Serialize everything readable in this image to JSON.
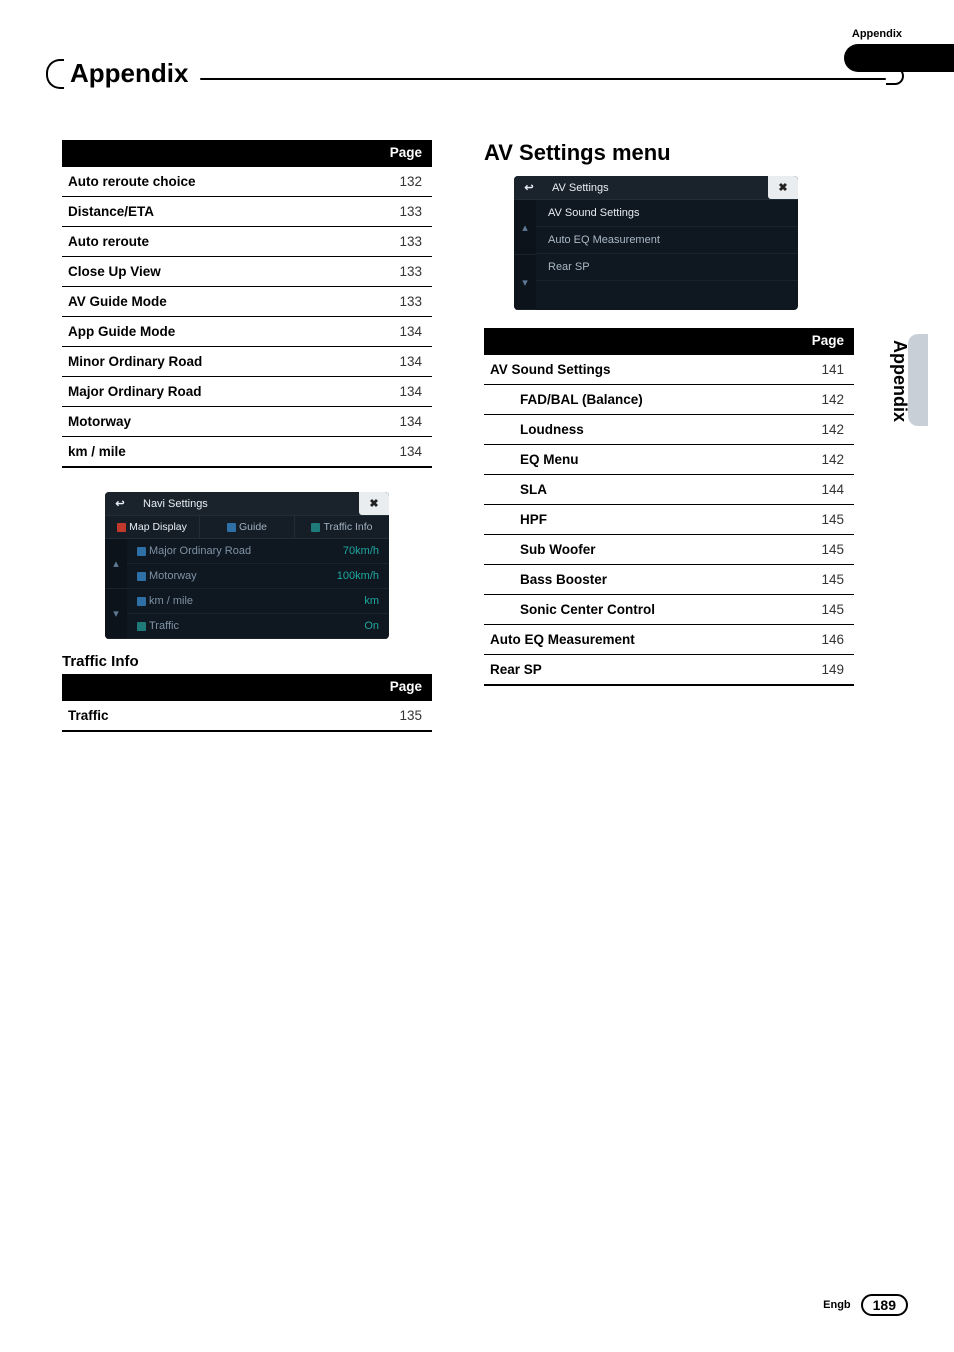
{
  "header": {
    "right_label": "Appendix",
    "title": "Appendix"
  },
  "side": {
    "label": "Appendix"
  },
  "footer": {
    "lang": "Engb",
    "page": "189"
  },
  "left": {
    "page_header": "Page",
    "rows": [
      {
        "label": "Auto reroute choice",
        "page": "132",
        "indent": false
      },
      {
        "label": "Distance/ETA",
        "page": "133",
        "indent": false
      },
      {
        "label": "Auto reroute",
        "page": "133",
        "indent": false
      },
      {
        "label": "Close Up View",
        "page": "133",
        "indent": false
      },
      {
        "label": "AV Guide Mode",
        "page": "133",
        "indent": false
      },
      {
        "label": "App Guide Mode",
        "page": "134",
        "indent": false
      },
      {
        "label": "Minor Ordinary Road",
        "page": "134",
        "indent": false
      },
      {
        "label": "Major Ordinary Road",
        "page": "134",
        "indent": false
      },
      {
        "label": "Motorway",
        "page": "134",
        "indent": false
      },
      {
        "label": "km / mile",
        "page": "134",
        "indent": false
      }
    ],
    "navi_shot": {
      "title": "Navi Settings",
      "tabs": [
        {
          "label": "Map Display",
          "active": true,
          "icon": "ic-red"
        },
        {
          "label": "Guide",
          "active": false,
          "icon": "ic-blue"
        },
        {
          "label": "Traffic Info",
          "active": false,
          "icon": "ic-teal"
        }
      ],
      "rows": [
        {
          "label": "Major Ordinary Road",
          "value": "70km/h",
          "icon": "ic-blue"
        },
        {
          "label": "Motorway",
          "value": "100km/h",
          "icon": "ic-blue"
        },
        {
          "label": "km / mile",
          "value": "km",
          "icon": "ic-blue"
        },
        {
          "label": "Traffic",
          "value": "On",
          "icon": "ic-teal"
        }
      ]
    },
    "traffic_heading": "Traffic Info",
    "traffic_rows": [
      {
        "label": "Traffic",
        "page": "135"
      }
    ]
  },
  "right": {
    "heading": "AV Settings menu",
    "av_shot": {
      "title": "AV Settings",
      "rows": [
        {
          "label": "AV Sound Settings",
          "bright": true
        },
        {
          "label": "Auto EQ Measurement",
          "bright": false
        },
        {
          "label": "Rear SP",
          "bright": false
        }
      ]
    },
    "page_header": "Page",
    "rows": [
      {
        "label": "AV Sound Settings",
        "page": "141",
        "indent": false
      },
      {
        "label": "FAD/BAL (Balance)",
        "page": "142",
        "indent": true
      },
      {
        "label": "Loudness",
        "page": "142",
        "indent": true
      },
      {
        "label": "EQ Menu",
        "page": "142",
        "indent": true
      },
      {
        "label": "SLA",
        "page": "144",
        "indent": true
      },
      {
        "label": "HPF",
        "page": "145",
        "indent": true
      },
      {
        "label": "Sub Woofer",
        "page": "145",
        "indent": true
      },
      {
        "label": "Bass Booster",
        "page": "145",
        "indent": true
      },
      {
        "label": "Sonic Center Control",
        "page": "145",
        "indent": true
      },
      {
        "label": "Auto EQ Measurement",
        "page": "146",
        "indent": false
      },
      {
        "label": "Rear SP",
        "page": "149",
        "indent": false
      }
    ]
  }
}
